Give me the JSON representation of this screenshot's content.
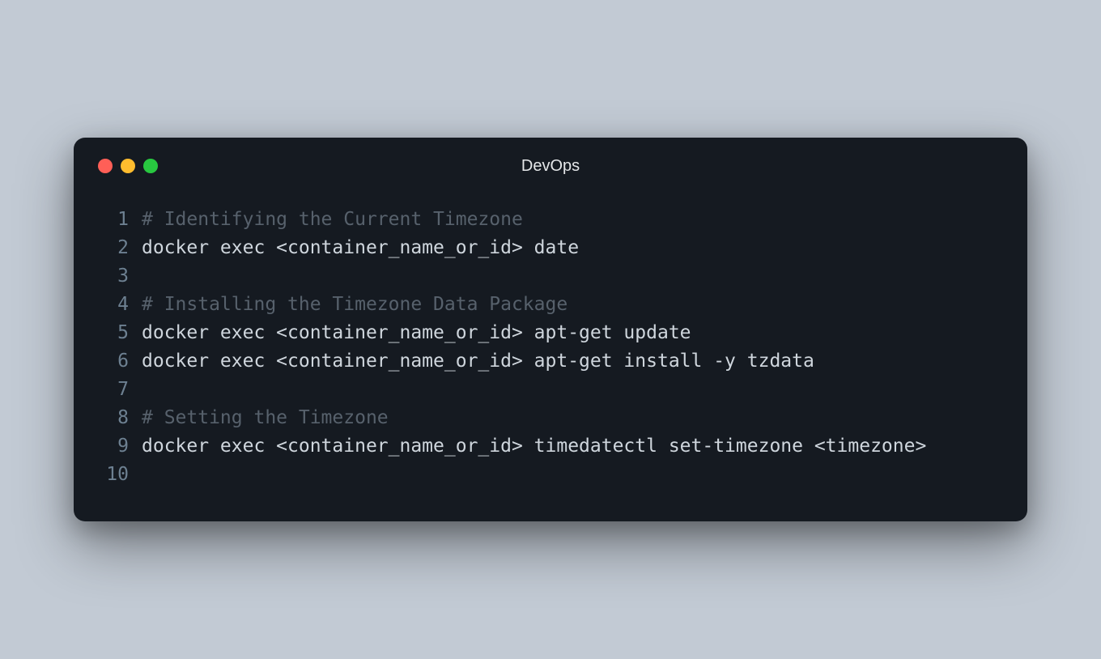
{
  "window": {
    "title": "DevOps"
  },
  "lines": [
    {
      "n": "1",
      "type": "comment",
      "text": "# Identifying the Current Timezone"
    },
    {
      "n": "2",
      "type": "cmd",
      "text": "docker exec <container_name_or_id> date"
    },
    {
      "n": "3",
      "type": "cmd",
      "text": ""
    },
    {
      "n": "4",
      "type": "comment",
      "text": "# Installing the Timezone Data Package"
    },
    {
      "n": "5",
      "type": "cmd",
      "text": "docker exec <container_name_or_id> apt-get update"
    },
    {
      "n": "6",
      "type": "cmd",
      "text": "docker exec <container_name_or_id> apt-get install -y tzdata"
    },
    {
      "n": "7",
      "type": "cmd",
      "text": ""
    },
    {
      "n": "8",
      "type": "comment",
      "text": "# Setting the Timezone"
    },
    {
      "n": "9",
      "type": "cmd",
      "text": "docker exec <container_name_or_id> timedatectl set-timezone <timezone>"
    },
    {
      "n": "10",
      "type": "cmd",
      "text": ""
    }
  ]
}
